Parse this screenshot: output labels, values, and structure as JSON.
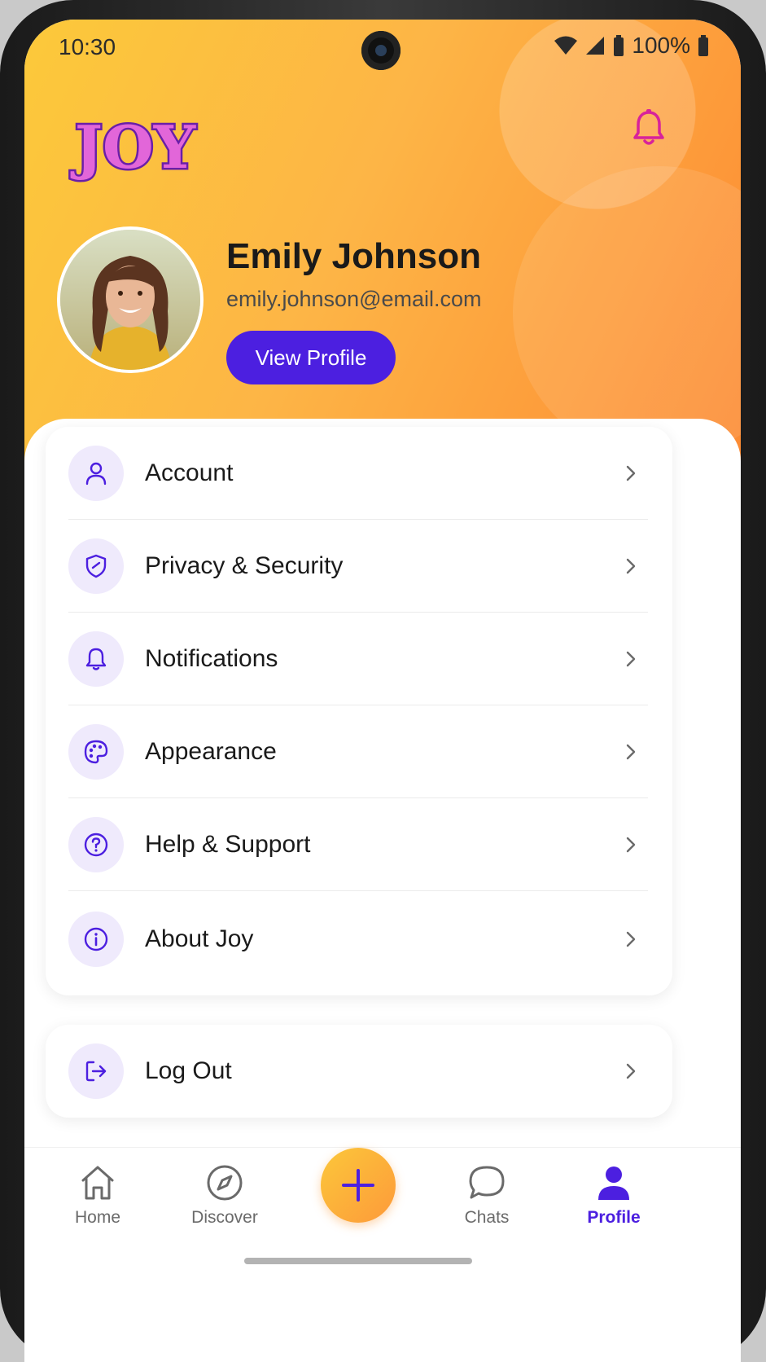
{
  "status_bar": {
    "time": "10:30",
    "battery": "100%"
  },
  "header": {
    "logo_text": "JOY",
    "notification_icon": "bell-icon"
  },
  "profile": {
    "name": "Emily Johnson",
    "email": "emily.johnson@email.com",
    "view_profile_label": "View Profile"
  },
  "menu": {
    "items": [
      {
        "label": "Account",
        "icon": "user-icon"
      },
      {
        "label": "Privacy & Security",
        "icon": "shield-icon"
      },
      {
        "label": "Notifications",
        "icon": "bell-icon"
      },
      {
        "label": "Appearance",
        "icon": "palette-icon"
      },
      {
        "label": "Help & Support",
        "icon": "help-circle-icon"
      },
      {
        "label": "About Joy",
        "icon": "info-icon"
      }
    ],
    "logout": {
      "label": "Log Out",
      "icon": "logout-icon"
    }
  },
  "bottom_nav": {
    "items": [
      {
        "label": "Home",
        "icon": "home-icon"
      },
      {
        "label": "Discover",
        "icon": "compass-icon"
      },
      {
        "label": "Chats",
        "icon": "chat-bubble-icon"
      },
      {
        "label": "Profile",
        "icon": "person-icon"
      }
    ],
    "active": "Profile",
    "fab_icon": "plus-icon"
  },
  "colors": {
    "accent": "#4c1fe0",
    "icon_bg": "#efeafc",
    "hero_start": "#fcc93a",
    "hero_end": "#fc8a33"
  }
}
